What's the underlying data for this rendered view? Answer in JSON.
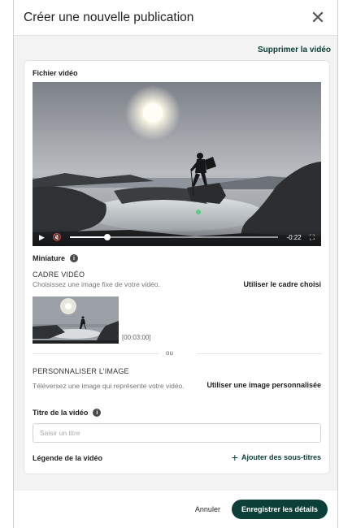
{
  "dialog": {
    "title": "Créer une nouvelle publication",
    "close_icon": "close-icon"
  },
  "video_section": {
    "delete_label": "Supprimer la vidéo",
    "file_label": "Fichier vidéo",
    "remaining_time": "-0:22",
    "progress_fraction": 0.18,
    "icons": [
      "play-icon",
      "mute-icon",
      "fullscreen-icon"
    ]
  },
  "thumbnail": {
    "label": "Miniature",
    "frame_title": "CADRE VIDÉO",
    "frame_description": "Choisissez une image fixe de votre vidéo.",
    "use_frame_label": "Utiliser le cadre choisi",
    "timestamp": "[00:03:00]",
    "or_label": "ou",
    "custom_title": "PERSONNALISER L’IMAGE",
    "custom_description": "Téléversez une image qui représente votre vidéo.",
    "use_custom_label": "Utiliser une image personnalisée"
  },
  "video_title": {
    "label": "Titre de la vidéo",
    "placeholder": "Saisir un titre",
    "value": ""
  },
  "caption": {
    "label": "Légende de la vidéo",
    "add_subtitles_label": "Ajouter des sous-titres"
  },
  "footer": {
    "cancel_label": "Annuler",
    "save_label": "Enregistrer les détails"
  },
  "colors": {
    "accent": "#0b3f37",
    "body_bg": "#f3f3f3"
  }
}
